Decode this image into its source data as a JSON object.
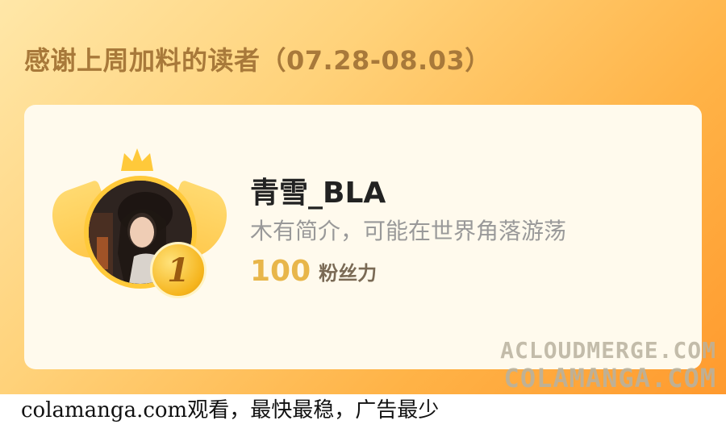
{
  "banner": {
    "title": "感谢上周加料的读者（07.28-08.03）"
  },
  "reader": {
    "rank": "1",
    "name": "青雪_BLA",
    "intro": "木有简介，可能在世界角落游荡",
    "fans_count": "100",
    "fans_label": "粉丝力"
  },
  "watermarks": [
    "ACLOUDMERGE.COM",
    "COLAMANGA.COM"
  ],
  "footer": {
    "text": "colamanga.com观看，最快最稳，广告最少"
  },
  "colors": {
    "banner_start": "#ffe7a8",
    "banner_end": "#ff9a2e",
    "title": "#a8793a",
    "card_bg": "#fffaed",
    "gold": "#ffc93a",
    "fans_count": "#e8b64a"
  },
  "icons": {
    "crown": "crown-icon",
    "wings": "wing-decoration",
    "badge": "rank-badge"
  }
}
